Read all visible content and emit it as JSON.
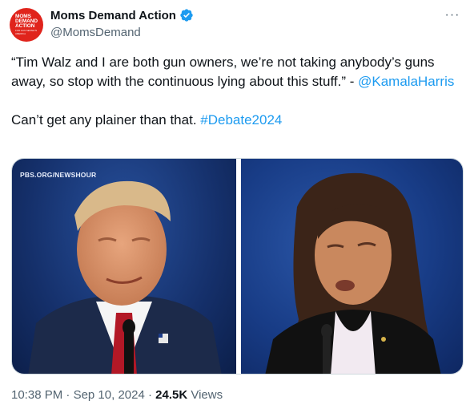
{
  "author": {
    "display_name": "Moms Demand Action",
    "handle": "@MomsDemand",
    "avatar_lines": [
      "MOMS",
      "DEMAND",
      "ACTION"
    ],
    "avatar_tagline": "FOR GUN SENSE IN AMERICA",
    "avatar_color": "#e0241c",
    "verified_color": "#1d9bf0"
  },
  "more_menu": {
    "icon": "more-horizontal-icon",
    "label": "···"
  },
  "tweet": {
    "quote_text": "“Tim Walz and I are both gun owners, we’re not taking anybody’s guns away, so stop with the continuous lying about this stuff.” -",
    "mention": "@KamalaHarris",
    "second_text": "Can’t get any plainer than that.",
    "hashtag": "#Debate2024",
    "link_color": "#1d9bf0"
  },
  "media": {
    "watermark": "PBS.ORG/NEWSHOUR",
    "left_image": "debate-still-trump",
    "right_image": "debate-still-harris"
  },
  "meta": {
    "time": "10:38 PM",
    "date": "Sep 10, 2024",
    "separator": "·",
    "views_count": "24.5K",
    "views_label": "Views"
  }
}
